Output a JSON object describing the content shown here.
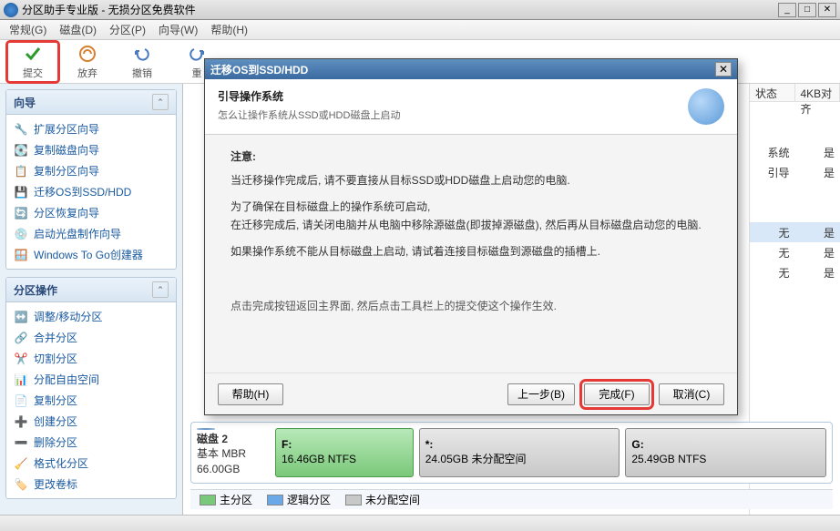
{
  "window": {
    "title": "分区助手专业版 - 无损分区免费软件"
  },
  "menu": {
    "items": [
      "常规(G)",
      "磁盘(D)",
      "分区(P)",
      "向导(W)",
      "帮助(H)"
    ]
  },
  "toolbar": {
    "apply": "提交",
    "discard": "放弃",
    "undo": "撤销",
    "redo": "重"
  },
  "sidebar": {
    "wizard_title": "向导",
    "wizard_items": [
      "扩展分区向导",
      "复制磁盘向导",
      "复制分区向导",
      "迁移OS到SSD/HDD",
      "分区恢复向导",
      "启动光盘制作向导",
      "Windows To Go创建器"
    ],
    "ops_title": "分区操作",
    "ops_items": [
      "调整/移动分区",
      "合并分区",
      "切割分区",
      "分配自由空间",
      "复制分区",
      "创建分区",
      "删除分区",
      "格式化分区",
      "更改卷标"
    ]
  },
  "columns": {
    "status": "状态",
    "align": "4KB对齐"
  },
  "rows": [
    {
      "status": "系统",
      "align": "是",
      "sel": false
    },
    {
      "status": "引导",
      "align": "是",
      "sel": false
    },
    {
      "status": "无",
      "align": "是",
      "sel": true
    },
    {
      "status": "无",
      "align": "是",
      "sel": false
    },
    {
      "status": "无",
      "align": "是",
      "sel": false
    }
  ],
  "disk": {
    "label": "磁盘 2",
    "type": "基本 MBR",
    "size": "66.00GB",
    "parts": [
      {
        "letter": "F:",
        "detail": "16.46GB NTFS",
        "style": "green",
        "flex": 2
      },
      {
        "letter": "*:",
        "detail": "24.05GB 未分配空间",
        "style": "gray",
        "flex": 3
      },
      {
        "letter": "G:",
        "detail": "25.49GB NTFS",
        "style": "gray",
        "flex": 3
      }
    ]
  },
  "legend": {
    "primary": "主分区",
    "logical": "逻辑分区",
    "unalloc": "未分配空间"
  },
  "dialog": {
    "title": "迁移OS到SSD/HDD",
    "header_title": "引导操作系统",
    "header_sub": "怎么让操作系统从SSD或HDD磁盘上启动",
    "note_title": "注意:",
    "line1": "当迁移操作完成后, 请不要直接从目标SSD或HDD磁盘上启动您的电脑.",
    "line2": "为了确保在目标磁盘上的操作系统可启动,",
    "line3": "在迁移完成后, 请关闭电脑并从电脑中移除源磁盘(即拔掉源磁盘), 然后再从目标磁盘启动您的电脑.",
    "line4": "如果操作系统不能从目标磁盘上启动, 请试着连接目标磁盘到源磁盘的插槽上.",
    "hint": "点击完成按钮返回主界面, 然后点击工具栏上的提交使这个操作生效.",
    "help": "帮助(H)",
    "back": "上一步(B)",
    "finish": "完成(F)",
    "cancel": "取消(C)"
  }
}
